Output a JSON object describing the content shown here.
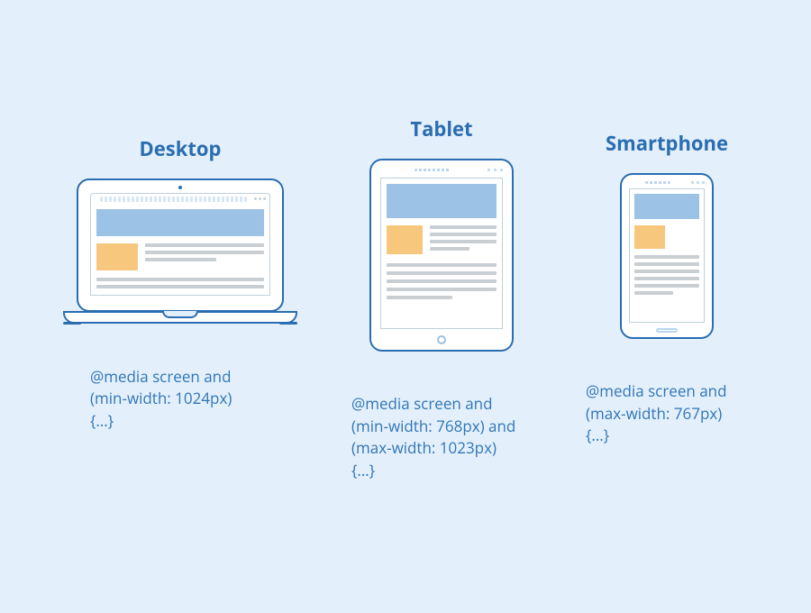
{
  "devices": {
    "desktop": {
      "title": "Desktop",
      "caption_l1": "@media screen and",
      "caption_l2": "(min-width: 1024px)",
      "caption_l3": "{...}"
    },
    "tablet": {
      "title": "Tablet",
      "caption_l1": "@media screen and",
      "caption_l2": "(min-width: 768px) and",
      "caption_l3": "(max-width: 1023px)",
      "caption_l4": "{...}"
    },
    "smartphone": {
      "title": "Smartphone",
      "caption_l1": "@media screen and",
      "caption_l2": "(max-width: 767px)",
      "caption_l3": "{...}"
    }
  },
  "colors": {
    "background": "#e3f0fc",
    "outline": "#2a6db0",
    "hero_block": "#9cc2e5",
    "thumb_block": "#f8c77e",
    "text_line": "#c9ced3"
  }
}
